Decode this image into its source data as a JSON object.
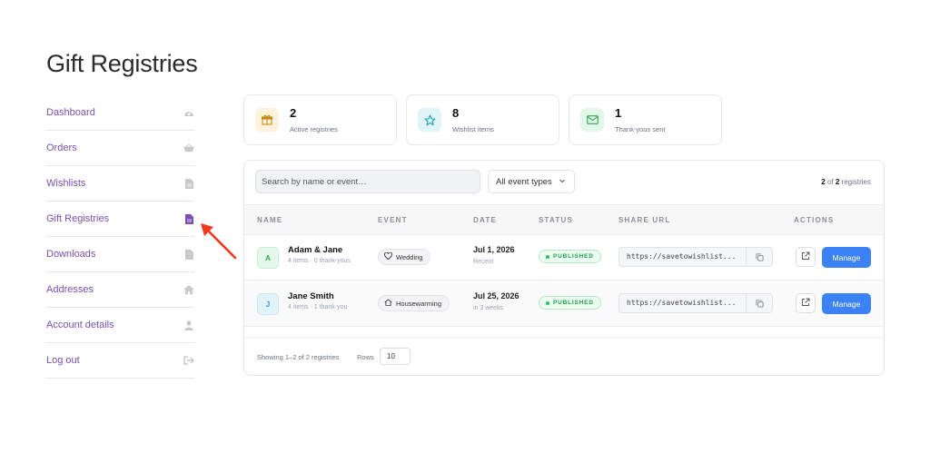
{
  "page": {
    "title": "Gift Registries"
  },
  "sidebar": {
    "items": [
      {
        "label": "Dashboard",
        "icon": "gauge-icon"
      },
      {
        "label": "Orders",
        "icon": "basket-icon"
      },
      {
        "label": "Wishlists",
        "icon": "file-icon"
      },
      {
        "label": "Gift Registries",
        "icon": "file-icon",
        "active": true
      },
      {
        "label": "Downloads",
        "icon": "file-icon"
      },
      {
        "label": "Addresses",
        "icon": "home-icon"
      },
      {
        "label": "Account details",
        "icon": "user-icon"
      },
      {
        "label": "Log out",
        "icon": "logout-icon"
      }
    ]
  },
  "stats": [
    {
      "value": "2",
      "label": "Active registries",
      "icon": "gift-icon",
      "bg": "#fdf2dc",
      "color": "#c2870f"
    },
    {
      "value": "8",
      "label": "Wishlist items",
      "icon": "star-icon",
      "bg": "#e0f5f8",
      "color": "#1aa3b8"
    },
    {
      "value": "1",
      "label": "Thank-yous sent",
      "icon": "mail-icon",
      "bg": "#e3f7e8",
      "color": "#2eaa56"
    }
  ],
  "toolbar": {
    "search_placeholder": "Search by name or event…",
    "event_filter": "All event types",
    "count_current": "2",
    "count_of": " of ",
    "count_total": "2",
    "count_suffix": " registries"
  },
  "table": {
    "headers": {
      "name": "NAME",
      "event": "EVENT",
      "date": "DATE",
      "status": "STATUS",
      "share_url": "SHARE URL",
      "actions": "ACTIONS"
    },
    "rows": [
      {
        "initial": "A",
        "avatar_bg": "#e6f8ea",
        "avatar_color": "#2eaa56",
        "name": "Adam & Jane",
        "sub": "4 items · 0 thank-yous",
        "event": "Wedding",
        "event_icon": "heart-icon",
        "date": "Jul 1, 2026",
        "date_sub": "Recent",
        "status": "PUBLISHED",
        "url": "https://savetowishlist...",
        "manage": "Manage"
      },
      {
        "initial": "J",
        "avatar_bg": "#e1f4fb",
        "avatar_color": "#2a9ad0",
        "name": "Jane Smith",
        "sub": "4 items · 1 thank-you",
        "event": "Housewarming",
        "event_icon": "house-icon",
        "date": "Jul 25, 2026",
        "date_sub": "in 3 weeks",
        "status": "PUBLISHED",
        "url": "https://savetowishlist...",
        "manage": "Manage"
      }
    ]
  },
  "footer": {
    "showing": "Showing 1–2 of 2 registries",
    "rows_label": "Rows",
    "rows_value": "10"
  },
  "colors": {
    "accent": "#3b82f6",
    "nav": "#7a4fb0",
    "annotation_arrow": "#ee3b1f"
  }
}
